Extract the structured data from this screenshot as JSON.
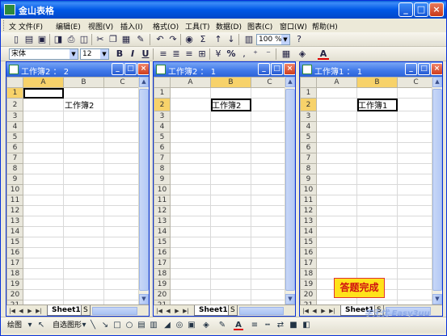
{
  "app": {
    "title": "金山表格"
  },
  "menu": [
    "文 文件(F)",
    "编辑(E)",
    "视图(V)",
    "插入(I)",
    "格式(O)",
    "工具(T)",
    "数据(D)",
    "图表(C)",
    "窗口(W)",
    "帮助(H)"
  ],
  "toolbar": {
    "zoom": "100 %",
    "font_name": "宋体",
    "font_size": "12",
    "bold": "B",
    "italic": "I",
    "underline": "U",
    "sum": "Σ",
    "percent": "%",
    "font_color_label": "A"
  },
  "windows": [
    {
      "title": "工作簿2 ： 2",
      "columns": [
        "A",
        "B",
        "C"
      ],
      "rows": [
        "1",
        "2",
        "3",
        "4",
        "5",
        "6",
        "7",
        "8",
        "9",
        "10",
        "11",
        "12",
        "13",
        "14",
        "15",
        "16",
        "17",
        "18",
        "19",
        "20",
        "21"
      ],
      "selected_cell": "A1",
      "highlight_row": "1",
      "highlight_col": "A",
      "cell_text": "工作簿2",
      "text_row": "2",
      "text_col": "B",
      "sheet_tab": "Sheet1",
      "sheet_tab_more": "S"
    },
    {
      "title": "工作簿2 ： 1",
      "columns": [
        "A",
        "B",
        "C"
      ],
      "rows": [
        "1",
        "2",
        "3",
        "4",
        "5",
        "6",
        "7",
        "8",
        "9",
        "10",
        "11",
        "12",
        "13",
        "14",
        "15",
        "16",
        "17",
        "18",
        "19",
        "20",
        "21"
      ],
      "selected_cell": "B2",
      "highlight_row": "2",
      "highlight_col": "B",
      "cell_text": "工作簿2",
      "text_row": "2",
      "text_col": "B",
      "sheet_tab": "Sheet1",
      "sheet_tab_more": "S"
    },
    {
      "title": "工作簿1 ： 1",
      "columns": [
        "A",
        "B",
        "C"
      ],
      "rows": [
        "1",
        "2",
        "3",
        "4",
        "5",
        "6",
        "7",
        "8",
        "9",
        "10",
        "11",
        "12",
        "13",
        "14",
        "15",
        "16",
        "17",
        "18",
        "19",
        "20",
        "21"
      ],
      "selected_cell": "B2",
      "highlight_row": "2",
      "highlight_col": "B",
      "cell_text": "工作簿1",
      "text_row": "2",
      "text_col": "B",
      "sheet_tab": "Sheet1",
      "sheet_tab_more": "S"
    }
  ],
  "overlay": {
    "done_badge": "答题完成",
    "watermark": "学无忧 Easy3uu"
  },
  "drawbar": {
    "draw_label": "绘图",
    "autoshape_label": "自选图形"
  },
  "colors": {
    "titlebar": "#0058e6",
    "highlight": "#f7d26a",
    "badge_bg": "#ffe21a",
    "badge_text": "#d01010"
  }
}
